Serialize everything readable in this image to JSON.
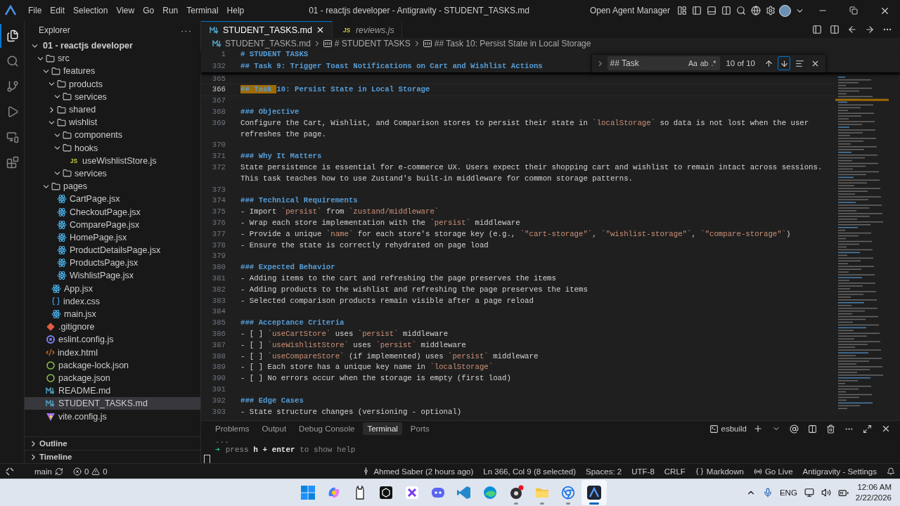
{
  "title_bar": {
    "menu": [
      "File",
      "Edit",
      "Selection",
      "View",
      "Go",
      "Run",
      "Terminal",
      "Help"
    ],
    "title": "01 - reactjs developer - Antigravity - STUDENT_TASKS.md",
    "agent_button": "Open Agent Manager"
  },
  "activity_bar": [
    {
      "kind": "explorer",
      "selected": true
    },
    {
      "kind": "search",
      "selected": false
    },
    {
      "kind": "source-control",
      "selected": false
    },
    {
      "kind": "run",
      "selected": false
    },
    {
      "kind": "remote",
      "selected": false
    },
    {
      "kind": "extensions",
      "selected": false
    }
  ],
  "sidebar": {
    "title": "Explorer",
    "more": "···",
    "tree": [
      {
        "name": "01 - reactjs developer",
        "kind": "root",
        "expanded": true,
        "selected": false,
        "children": [
          {
            "name": "src",
            "kind": "folder",
            "expanded": true,
            "selected": false,
            "children": [
              {
                "name": "features",
                "kind": "folder",
                "expanded": true,
                "selected": false,
                "children": [
                  {
                    "name": "products",
                    "kind": "folder",
                    "expanded": true,
                    "selected": false,
                    "children": [
                      {
                        "name": "services",
                        "kind": "folder",
                        "expanded": true,
                        "selected": false
                      }
                    ]
                  },
                  {
                    "name": "shared",
                    "kind": "folder",
                    "expanded": false,
                    "selected": false
                  },
                  {
                    "name": "wishlist",
                    "kind": "folder",
                    "expanded": true,
                    "selected": false,
                    "children": [
                      {
                        "name": "components",
                        "kind": "folder",
                        "expanded": true,
                        "selected": false
                      },
                      {
                        "name": "hooks",
                        "kind": "folder",
                        "expanded": true,
                        "selected": false,
                        "children": [
                          {
                            "name": "useWishlistStore.js",
                            "kind": "js",
                            "badge": "JS",
                            "selected": false
                          }
                        ]
                      },
                      {
                        "name": "services",
                        "kind": "folder",
                        "expanded": true,
                        "selected": false
                      }
                    ]
                  }
                ]
              },
              {
                "name": "pages",
                "kind": "folder",
                "expanded": true,
                "selected": false,
                "children": [
                  {
                    "name": "CartPage.jsx",
                    "kind": "react",
                    "selected": false
                  },
                  {
                    "name": "CheckoutPage.jsx",
                    "kind": "react",
                    "selected": false
                  },
                  {
                    "name": "ComparePage.jsx",
                    "kind": "react",
                    "selected": false
                  },
                  {
                    "name": "HomePage.jsx",
                    "kind": "react",
                    "selected": false
                  },
                  {
                    "name": "ProductDetailsPage.jsx",
                    "kind": "react",
                    "selected": false
                  },
                  {
                    "name": "ProductsPage.jsx",
                    "kind": "react",
                    "selected": false
                  },
                  {
                    "name": "WishlistPage.jsx",
                    "kind": "react",
                    "selected": false
                  }
                ]
              },
              {
                "name": "App.jsx",
                "kind": "react",
                "selected": false
              },
              {
                "name": "index.css",
                "kind": "css",
                "selected": false
              },
              {
                "name": "main.jsx",
                "kind": "react",
                "selected": false
              }
            ]
          },
          {
            "name": ".gitignore",
            "kind": "git",
            "selected": false
          },
          {
            "name": "eslint.config.js",
            "kind": "eslint",
            "selected": false
          },
          {
            "name": "index.html",
            "kind": "html",
            "selected": false
          },
          {
            "name": "package-lock.json",
            "kind": "json",
            "selected": false
          },
          {
            "name": "package.json",
            "kind": "json",
            "selected": false
          },
          {
            "name": "README.md",
            "kind": "md",
            "selected": false
          },
          {
            "name": "STUDENT_TASKS.md",
            "kind": "md",
            "selected": true
          },
          {
            "name": "vite.config.js",
            "kind": "vite",
            "selected": false
          }
        ]
      }
    ],
    "sections": [
      {
        "title": "Outline",
        "expanded": false
      },
      {
        "title": "Timeline",
        "expanded": false
      }
    ]
  },
  "tabs": [
    {
      "label": "STUDENT_TASKS.md",
      "kind": "md",
      "selected": true,
      "preview": false
    },
    {
      "label": "reviews.js",
      "kind": "js",
      "badge": "JS",
      "selected": false,
      "preview": true
    }
  ],
  "breadcrumb": [
    {
      "text": "STUDENT_TASKS.md",
      "kind": "md"
    },
    {
      "text": "# STUDENT TASKS",
      "kind": "symbol"
    },
    {
      "text": "## Task 10: Persist State in Local Storage",
      "kind": "symbol"
    }
  ],
  "sticky_lines": [
    {
      "number": "1",
      "text": "# STUDENT TASKS"
    },
    {
      "number": "332",
      "text": "## Task 9: Trigger Toast Notifications on Cart and Wishlist Actions"
    }
  ],
  "find": {
    "query": "## Task",
    "toggles": [
      "Aa",
      "ab",
      ".*"
    ],
    "count": "10 of 10"
  },
  "lines": [
    {
      "number": "365",
      "kind": "blank",
      "current": false
    },
    {
      "number": "366",
      "kind": "heading",
      "current": true,
      "parts": [
        {
          "text": "## Task ",
          "kind": "match"
        },
        {
          "text": "10: Persist State in Local Storage",
          "kind": "plain"
        }
      ]
    },
    {
      "number": "367",
      "kind": "blank",
      "current": false
    },
    {
      "number": "368",
      "kind": "heading",
      "current": false,
      "parts": [
        {
          "text": "### Objective",
          "kind": "plain"
        }
      ]
    },
    {
      "number": "369",
      "kind": "text",
      "current": false,
      "parts": [
        {
          "text": "Configure the Cart, Wishlist, and Comparison stores to persist their state in ",
          "kind": "plain"
        },
        {
          "text": "`localStorage`",
          "kind": "code"
        },
        {
          "text": " so data is not lost when the user refreshes the page.",
          "kind": "plain"
        }
      ]
    },
    {
      "number": "370",
      "kind": "blank",
      "current": false
    },
    {
      "number": "371",
      "kind": "heading",
      "current": false,
      "parts": [
        {
          "text": "### Why It Matters",
          "kind": "plain"
        }
      ]
    },
    {
      "number": "372",
      "kind": "text",
      "current": false,
      "parts": [
        {
          "text": "State persistence is essential for e-commerce UX. Users expect their shopping cart and wishlist to remain intact across sessions. This task teaches how to use Zustand's built-in middleware for common storage patterns.",
          "kind": "plain"
        }
      ]
    },
    {
      "number": "373",
      "kind": "blank",
      "current": false
    },
    {
      "number": "374",
      "kind": "heading",
      "current": false,
      "parts": [
        {
          "text": "### Technical Requirements",
          "kind": "plain"
        }
      ]
    },
    {
      "number": "375",
      "kind": "text",
      "current": false,
      "parts": [
        {
          "text": "- Import ",
          "kind": "plain"
        },
        {
          "text": "`persist`",
          "kind": "code"
        },
        {
          "text": " from ",
          "kind": "plain"
        },
        {
          "text": "`zustand/middleware`",
          "kind": "code"
        }
      ]
    },
    {
      "number": "376",
      "kind": "text",
      "current": false,
      "parts": [
        {
          "text": "- Wrap each store implementation with the ",
          "kind": "plain"
        },
        {
          "text": "`persist`",
          "kind": "code"
        },
        {
          "text": " middleware",
          "kind": "plain"
        }
      ]
    },
    {
      "number": "377",
      "kind": "text",
      "current": false,
      "parts": [
        {
          "text": "- Provide a unique ",
          "kind": "plain"
        },
        {
          "text": "`name`",
          "kind": "code"
        },
        {
          "text": " for each store's storage key (e.g., ",
          "kind": "plain"
        },
        {
          "text": "`\"cart-storage\"`",
          "kind": "code"
        },
        {
          "text": ", ",
          "kind": "plain"
        },
        {
          "text": "`\"wishlist-storage\"`",
          "kind": "code"
        },
        {
          "text": ", ",
          "kind": "plain"
        },
        {
          "text": "`\"compare-storage\"`",
          "kind": "code"
        },
        {
          "text": ")",
          "kind": "plain"
        }
      ]
    },
    {
      "number": "378",
      "kind": "text",
      "current": false,
      "parts": [
        {
          "text": "- Ensure the state is correctly rehydrated on page load",
          "kind": "plain"
        }
      ]
    },
    {
      "number": "379",
      "kind": "blank",
      "current": false
    },
    {
      "number": "380",
      "kind": "heading",
      "current": false,
      "parts": [
        {
          "text": "### Expected Behavior",
          "kind": "plain"
        }
      ]
    },
    {
      "number": "381",
      "kind": "text",
      "current": false,
      "parts": [
        {
          "text": "- Adding items to the cart and refreshing the page preserves the items",
          "kind": "plain"
        }
      ]
    },
    {
      "number": "382",
      "kind": "text",
      "current": false,
      "parts": [
        {
          "text": "- Adding products to the wishlist and refreshing the page preserves the items",
          "kind": "plain"
        }
      ]
    },
    {
      "number": "383",
      "kind": "text",
      "current": false,
      "parts": [
        {
          "text": "- Selected comparison products remain visible after a page reload",
          "kind": "plain"
        }
      ]
    },
    {
      "number": "384",
      "kind": "blank",
      "current": false
    },
    {
      "number": "385",
      "kind": "heading",
      "current": false,
      "parts": [
        {
          "text": "### Acceptance Criteria",
          "kind": "plain"
        }
      ]
    },
    {
      "number": "386",
      "kind": "text",
      "current": false,
      "parts": [
        {
          "text": "- [ ] ",
          "kind": "plain"
        },
        {
          "text": "`useCartStore`",
          "kind": "code"
        },
        {
          "text": " uses ",
          "kind": "plain"
        },
        {
          "text": "`persist`",
          "kind": "code"
        },
        {
          "text": " middleware",
          "kind": "plain"
        }
      ]
    },
    {
      "number": "387",
      "kind": "text",
      "current": false,
      "parts": [
        {
          "text": "- [ ] ",
          "kind": "plain"
        },
        {
          "text": "`useWishlistStore`",
          "kind": "code"
        },
        {
          "text": " uses ",
          "kind": "plain"
        },
        {
          "text": "`persist`",
          "kind": "code"
        },
        {
          "text": " middleware",
          "kind": "plain"
        }
      ]
    },
    {
      "number": "388",
      "kind": "text",
      "current": false,
      "parts": [
        {
          "text": "- [ ] ",
          "kind": "plain"
        },
        {
          "text": "`useCompareStore`",
          "kind": "code"
        },
        {
          "text": " (if implemented) uses ",
          "kind": "plain"
        },
        {
          "text": "`persist`",
          "kind": "code"
        },
        {
          "text": " middleware",
          "kind": "plain"
        }
      ]
    },
    {
      "number": "389",
      "kind": "text",
      "current": false,
      "parts": [
        {
          "text": "- [ ] Each store has a unique key name in ",
          "kind": "plain"
        },
        {
          "text": "`localStorage`",
          "kind": "code"
        }
      ]
    },
    {
      "number": "390",
      "kind": "text",
      "current": false,
      "parts": [
        {
          "text": "- [ ] No errors occur when the storage is empty (first load)",
          "kind": "plain"
        }
      ]
    },
    {
      "number": "391",
      "kind": "blank",
      "current": false
    },
    {
      "number": "392",
      "kind": "heading",
      "current": false,
      "parts": [
        {
          "text": "### Edge Cases",
          "kind": "plain"
        }
      ]
    },
    {
      "number": "393",
      "kind": "text",
      "current": false,
      "parts": [
        {
          "text": "- State structure changes (versioning - optional)",
          "kind": "plain"
        }
      ]
    }
  ],
  "panel": {
    "tabs": [
      {
        "label": "Problems",
        "selected": false
      },
      {
        "label": "Output",
        "selected": false
      },
      {
        "label": "Debug Console",
        "selected": false
      },
      {
        "label": "Terminal",
        "selected": true
      },
      {
        "label": "Ports",
        "selected": false
      }
    ],
    "terminal_name": "esbuild",
    "overflow": "...",
    "prompt": "➜",
    "hint": "press **h + enter** to show help"
  },
  "status_bar": {
    "branch": "main",
    "errors": "0",
    "warnings": "0",
    "items": [
      {
        "kind": "blame",
        "text": "Ahmed Saber (2 hours ago)"
      },
      {
        "kind": "plain",
        "text": "Ln 366, Col 9 (8 selected)"
      },
      {
        "kind": "plain",
        "text": "Spaces: 2"
      },
      {
        "kind": "plain",
        "text": "UTF-8"
      },
      {
        "kind": "plain",
        "text": "CRLF"
      },
      {
        "kind": "language",
        "text": "Markdown"
      },
      {
        "kind": "live",
        "text": "Go Live"
      },
      {
        "kind": "plain",
        "text": "Antigravity - Settings"
      }
    ]
  },
  "taskbar": {
    "apps": [
      {
        "kind": "start",
        "open": false,
        "active": false
      },
      {
        "kind": "copilot",
        "open": false,
        "active": false
      },
      {
        "kind": "llama",
        "open": false,
        "active": false
      },
      {
        "kind": "cube",
        "open": false,
        "active": false
      },
      {
        "kind": "cross",
        "open": false,
        "active": false
      },
      {
        "kind": "discord",
        "open": false,
        "active": false
      },
      {
        "kind": "vscode",
        "open": false,
        "active": false
      },
      {
        "kind": "edge",
        "open": false,
        "active": false
      },
      {
        "kind": "obs",
        "open": true,
        "active": false
      },
      {
        "kind": "files",
        "open": true,
        "active": false
      },
      {
        "kind": "chrome",
        "open": true,
        "active": false
      },
      {
        "kind": "antigravity",
        "open": true,
        "active": true
      }
    ],
    "language": "ENG",
    "time": "12:06 AM",
    "date": "2/22/2026"
  }
}
